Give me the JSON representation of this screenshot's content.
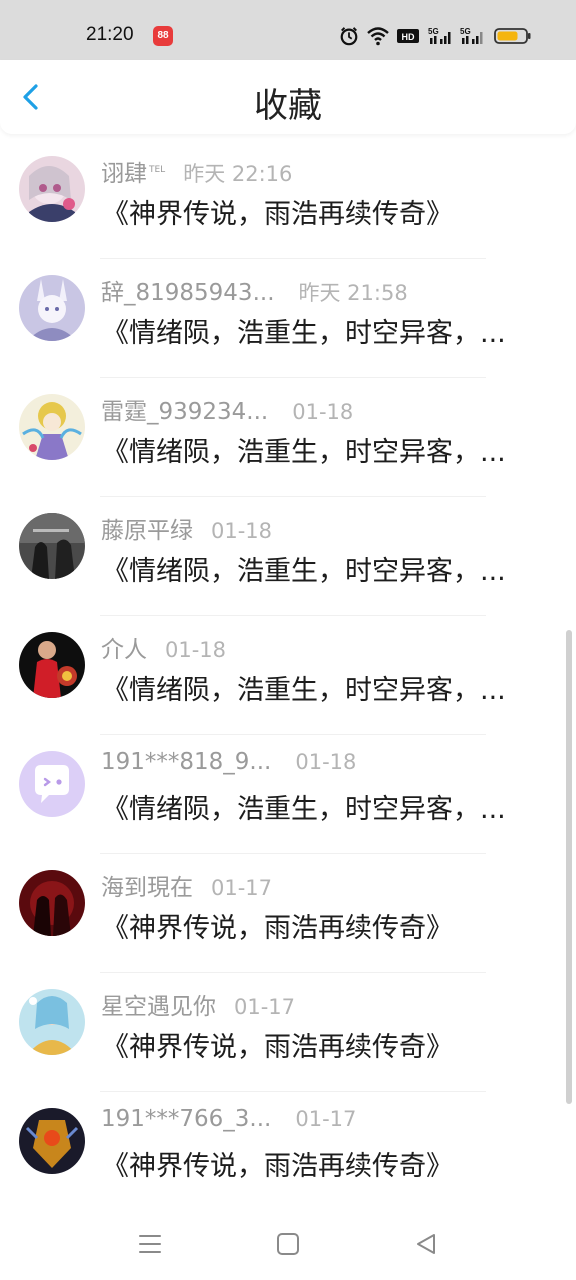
{
  "status_bar": {
    "time": "21:20",
    "app_badge": "88",
    "icons": [
      "alarm-icon",
      "wifi-icon",
      "hd-icon",
      "signal-5g-icon",
      "signal-5g-icon",
      "battery-icon"
    ],
    "battery_color": "#f5b50f"
  },
  "header": {
    "title": "收藏",
    "back_icon": "chevron-left-icon",
    "accent_color": "#1ea0e6"
  },
  "favorites": [
    {
      "name": "诩肆",
      "badge": "TEL",
      "time": "昨天 22:16",
      "title": "《神界传说，雨浩再续传奇》"
    },
    {
      "name": "辞_81985943...",
      "badge": "",
      "time": "昨天 21:58",
      "title": "《情绪陨，浩重生，时空异客，..."
    },
    {
      "name": "雷霆_939234...",
      "badge": "",
      "time": "01-18",
      "title": "《情绪陨，浩重生，时空异客，..."
    },
    {
      "name": "藤原平绿",
      "badge": "",
      "time": "01-18",
      "title": "《情绪陨，浩重生，时空异客，..."
    },
    {
      "name": "介人",
      "badge": "",
      "time": "01-18",
      "title": "《情绪陨，浩重生，时空异客，..."
    },
    {
      "name": "191***818_9...",
      "badge": "",
      "time": "01-18",
      "title": "《情绪陨，浩重生，时空异客，..."
    },
    {
      "name": "海到現在",
      "badge": "",
      "time": "01-17",
      "title": "《神界传说，雨浩再续传奇》"
    },
    {
      "name": "星空遇见你",
      "badge": "",
      "time": "01-17",
      "title": "《神界传说，雨浩再续传奇》"
    },
    {
      "name": "191***766_3...",
      "badge": "",
      "time": "01-17",
      "title": "《神界传说，雨浩再续传奇》"
    }
  ],
  "nav_bar": {
    "icons": [
      "menu-icon",
      "home-square-icon",
      "back-triangle-icon"
    ]
  }
}
